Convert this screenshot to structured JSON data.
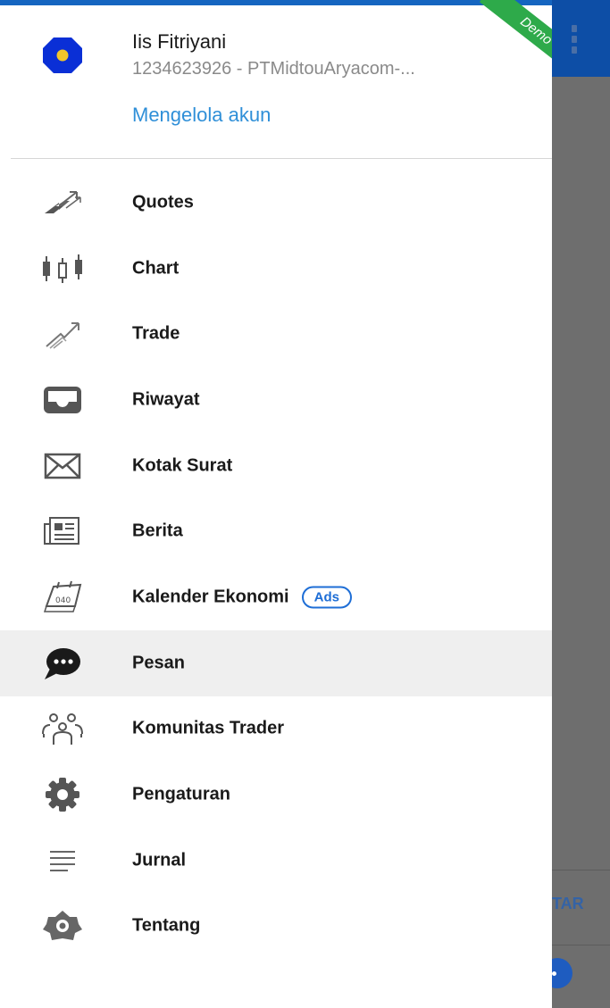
{
  "account": {
    "name": "Iis Fitriyani",
    "id_line": "1234623926 - PTMidtouAryacom-...",
    "manage_label": "Mengelola akun",
    "badge": "Demo"
  },
  "menu": [
    {
      "label": "Quotes",
      "icon": "quotes-icon"
    },
    {
      "label": "Chart",
      "icon": "candlestick-chart-icon"
    },
    {
      "label": "Trade",
      "icon": "trade-icon"
    },
    {
      "label": "Riwayat",
      "icon": "inbox-tray-icon"
    },
    {
      "label": "Kotak Surat",
      "icon": "envelope-icon"
    },
    {
      "label": "Berita",
      "icon": "newspaper-icon"
    },
    {
      "label": "Kalender Ekonomi",
      "icon": "calendar-icon",
      "badge": "Ads"
    },
    {
      "label": "Pesan",
      "icon": "chat-bubble-icon",
      "active": true
    },
    {
      "label": "Komunitas Trader",
      "icon": "community-icon"
    },
    {
      "label": "Pengaturan",
      "icon": "gear-icon"
    },
    {
      "label": "Jurnal",
      "icon": "lines-icon"
    },
    {
      "label": "Tentang",
      "icon": "about-icon"
    }
  ],
  "background": {
    "partial_button_text": "TAR"
  },
  "colors": {
    "accent": "#1565c0",
    "link": "#2f8fd8",
    "demo_ribbon": "#2eaa4a",
    "overlay": "#6e6e6e"
  }
}
